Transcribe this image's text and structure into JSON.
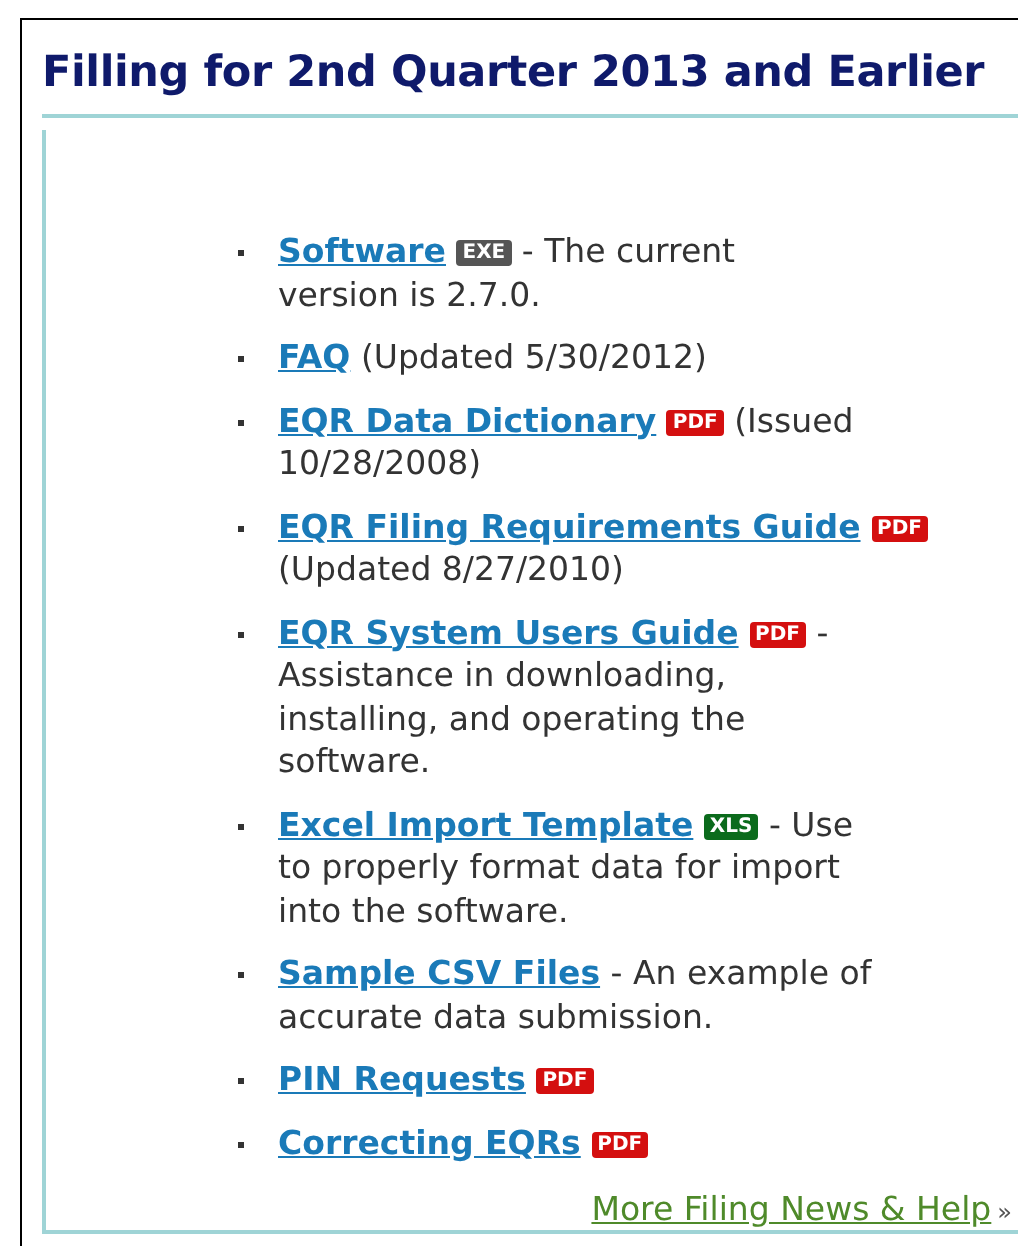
{
  "title": "Filling for 2nd Quarter 2013 and Earlier",
  "items": [
    {
      "link": "Software",
      "badge": {
        "kind": "exe",
        "label": "EXE"
      },
      "text_lines": [
        "- The current",
        "version is 2.7.0."
      ]
    },
    {
      "link": "FAQ",
      "text_lines": [
        "(Updated 5/30/2012)"
      ]
    },
    {
      "link": "EQR Data Dictionary",
      "badge": {
        "kind": "pdf",
        "label": "PDF"
      },
      "text_lines": [
        "(Issued",
        "10/28/2008)"
      ]
    },
    {
      "link": "EQR Filing Requirements Guide",
      "badge": {
        "kind": "pdf",
        "label": "PDF"
      },
      "text_lines": [
        "(Updated 8/27/2010)"
      ]
    },
    {
      "link": "EQR System Users Guide",
      "badge": {
        "kind": "pdf",
        "label": "PDF"
      },
      "text_lines": [
        "-",
        "Assistance in downloading,",
        "installing, and operating the",
        "software."
      ]
    },
    {
      "link": "Excel Import Template",
      "badge": {
        "kind": "xls",
        "label": "XLS"
      },
      "text_lines": [
        "- Use",
        "to properly format data for import",
        "into the software."
      ]
    },
    {
      "link": "Sample CSV Files",
      "text_lines": [
        "- An example of",
        "accurate data submission."
      ]
    },
    {
      "link": "PIN Requests",
      "badge": {
        "kind": "pdf",
        "label": "PDF"
      }
    },
    {
      "link": "Correcting EQRs",
      "badge": {
        "kind": "pdf",
        "label": "PDF"
      }
    }
  ],
  "more": {
    "link": "More Filing News & Help",
    "arrow": "»"
  }
}
